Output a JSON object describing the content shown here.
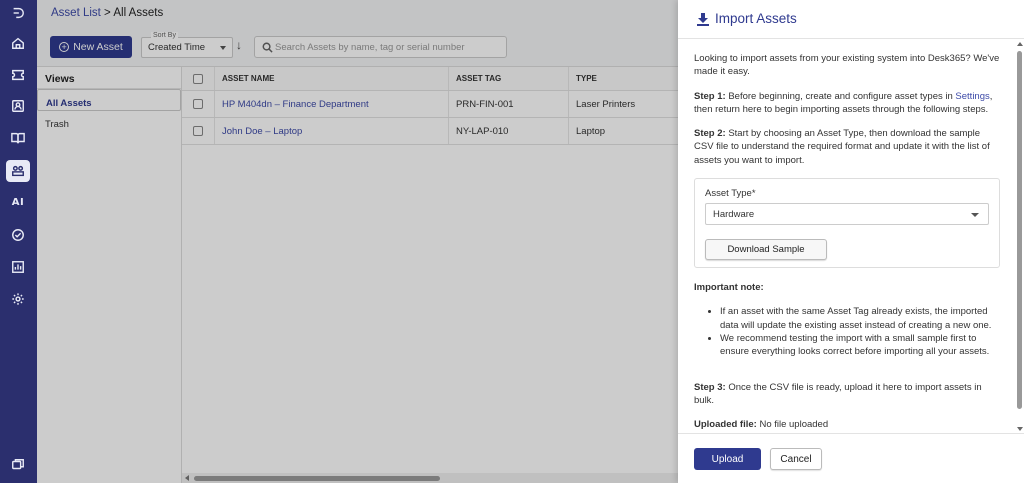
{
  "breadcrumb": {
    "parent": "Asset List",
    "separator": " > ",
    "current": "All Assets"
  },
  "toolbar": {
    "new_asset_label": "New Asset",
    "sort_label": "Sort By",
    "sort_value": "Created Time",
    "sort_direction": "↓",
    "search_placeholder": "Search Assets by name, tag or serial number"
  },
  "views": {
    "title": "Views",
    "items": [
      {
        "label": "All Assets",
        "selected": true
      },
      {
        "label": "Trash",
        "selected": false
      }
    ]
  },
  "table": {
    "columns": [
      "ASSET NAME",
      "ASSET TAG",
      "TYPE"
    ],
    "rows": [
      {
        "name": "HP M404dn – Finance Department",
        "tag": "PRN-FIN-001",
        "type": "Laser Printers"
      },
      {
        "name": "John Doe – Laptop",
        "tag": "NY-LAP-010",
        "type": "Laptop"
      }
    ]
  },
  "nav_rail": {
    "items": [
      "logo-icon",
      "home-icon",
      "tickets-icon",
      "contacts-icon",
      "knowledge-base-icon",
      "assets-icon",
      "ai-icon",
      "tasks-icon",
      "reports-icon",
      "settings-icon",
      "chat-icon"
    ],
    "ai_label": "AI",
    "active": "assets-icon"
  },
  "drawer": {
    "title": "Import Assets",
    "intro": "Looking to import assets from your existing system into Desk365? We've made it easy.",
    "step1_label": "Step 1:",
    "step1_text_a": " Before beginning, create and configure asset types in ",
    "step1_link": "Settings",
    "step1_text_b": ", then return here to begin importing assets through the following steps.",
    "step2_label": "Step 2:",
    "step2_text": " Start by choosing an Asset Type, then download the sample CSV file to understand the required format and update it with the list of assets you want to import.",
    "asset_type_label": "Asset Type*",
    "asset_type_value": "Hardware",
    "download_sample_label": "Download Sample",
    "important_note_label": "Important note:",
    "notes": [
      "If an asset with the same Asset Tag already exists, the imported data will update the existing asset instead of creating a new one.",
      "We recommend testing the import with a small sample first to ensure everything looks correct before importing all your assets."
    ],
    "step3_label": "Step 3:",
    "step3_text": " Once the CSV file is ready, upload it here to import assets in bulk.",
    "uploaded_file_label": "Uploaded file:",
    "uploaded_file_value": " No file uploaded",
    "upload_label": "Upload",
    "cancel_label": "Cancel"
  },
  "colors": {
    "brand": "#2f3a8f",
    "rail": "#2b2f6e",
    "link": "#3d4aa8"
  }
}
